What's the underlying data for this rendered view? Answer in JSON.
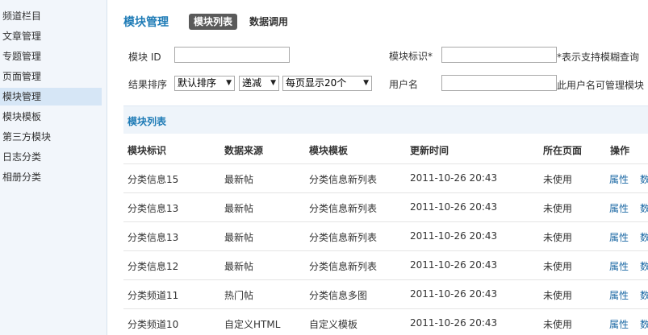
{
  "sidebar": {
    "items": [
      {
        "label": "频道栏目",
        "active": false
      },
      {
        "label": "文章管理",
        "active": false
      },
      {
        "label": "专题管理",
        "active": false
      },
      {
        "label": "页面管理",
        "active": false
      },
      {
        "label": "模块管理",
        "active": true
      },
      {
        "label": "模块模板",
        "active": false
      },
      {
        "label": "第三方模块",
        "active": false
      },
      {
        "label": "日志分类",
        "active": false
      },
      {
        "label": "相册分类",
        "active": false
      }
    ]
  },
  "header": {
    "title": "模块管理",
    "tabs": [
      {
        "label": "模块列表",
        "active": true
      },
      {
        "label": "数据调用",
        "active": false
      }
    ]
  },
  "filters": {
    "module_id_label": "模块 ID",
    "module_id_value": "",
    "module_mark_label": "模块标识",
    "required_mark": "*",
    "module_mark_value": "",
    "module_mark_hint": "*表示支持模糊查询",
    "sort_label": "结果排序",
    "sort_select": "默认排序",
    "order_select": "递减",
    "per_page_select": "每页显示20个",
    "username_label": "用户名",
    "username_value": "",
    "username_hint": "此用户名可管理模块"
  },
  "list": {
    "section_title": "模块列表",
    "columns": [
      "模块标识",
      "数据来源",
      "模块模板",
      "更新时间",
      "所在页面",
      "操作"
    ],
    "rows": [
      {
        "mark": "分类信息15",
        "source": "最新帖",
        "template": "分类信息新列表",
        "updated": "2011-10-26 20:43",
        "page": "未使用",
        "action1": "属性",
        "action2": "数"
      },
      {
        "mark": "分类信息13",
        "source": "最新帖",
        "template": "分类信息新列表",
        "updated": "2011-10-26 20:43",
        "page": "未使用",
        "action1": "属性",
        "action2": "数"
      },
      {
        "mark": "分类信息13",
        "source": "最新帖",
        "template": "分类信息新列表",
        "updated": "2011-10-26 20:43",
        "page": "未使用",
        "action1": "属性",
        "action2": "数"
      },
      {
        "mark": "分类信息12",
        "source": "最新帖",
        "template": "分类信息新列表",
        "updated": "2011-10-26 20:43",
        "page": "未使用",
        "action1": "属性",
        "action2": "数"
      },
      {
        "mark": "分类频道11",
        "source": "热门帖",
        "template": "分类信息多图",
        "updated": "2011-10-26 20:43",
        "page": "未使用",
        "action1": "属性",
        "action2": "数"
      },
      {
        "mark": "分类频道10",
        "source": "自定义HTML",
        "template": "自定义模板",
        "updated": "2011-10-26 20:43",
        "page": "未使用",
        "action1": "属性",
        "action2": "数"
      }
    ]
  },
  "colors": {
    "accent": "#1e7bb6",
    "link": "#1e6aa5",
    "sidebar_bg": "#f2f6fb",
    "sidebar_active": "#d6e6f6",
    "section_bg": "#eef4fa",
    "tab_active_bg": "#5a5a5a"
  }
}
